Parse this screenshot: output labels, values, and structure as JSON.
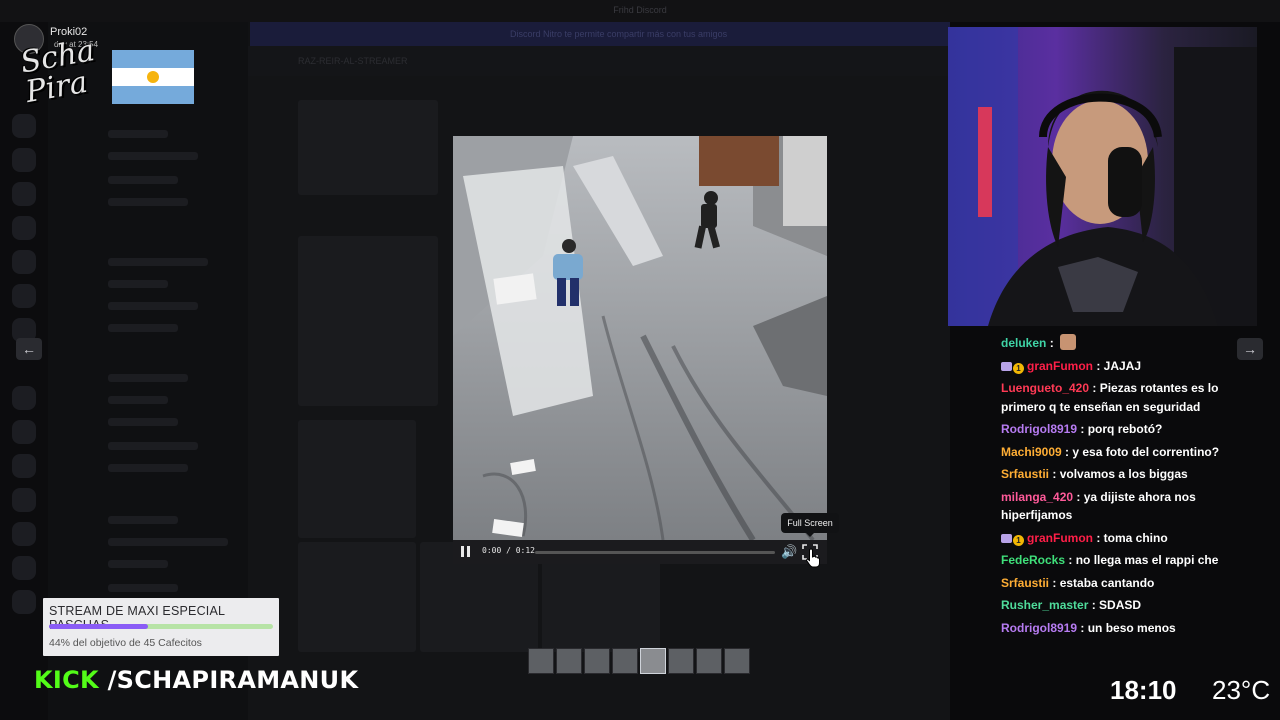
{
  "background": {
    "window_title": "Frihd Discord",
    "banner_text": "Discord Nitro te permite compartir más con tus amigos",
    "channel_header": "RAZ-REIR-AL-STREAMER"
  },
  "user_overlay": {
    "name": "Proki02",
    "time": "day at 23:54",
    "logo_text": "Scha Pira"
  },
  "video": {
    "time": "0:00 / 0:12",
    "progress": 0.0,
    "tooltip": "Full Screen",
    "thumbnail_count": 8,
    "active_thumbnail": 4
  },
  "nav": {
    "prev": "←",
    "next": "→"
  },
  "chat": [
    {
      "user": "deluken",
      "color": "#3fd4a6",
      "text": "",
      "emote": true,
      "badges": []
    },
    {
      "user": "granFumon",
      "color": "#ff1f48",
      "text": "JAJAJ",
      "badges": [
        "sub",
        "gold"
      ]
    },
    {
      "user": "Luengueto_420",
      "color": "#ff3a55",
      "text": "Piezas rotantes es lo primero q te enseñan en seguridad",
      "badges": []
    },
    {
      "user": "Rodrigol8919",
      "color": "#b77cf2",
      "text": "porq rebotó?",
      "badges": []
    },
    {
      "user": "Machi9009",
      "color": "#ffae35",
      "text": "y esa foto del correntino?",
      "badges": []
    },
    {
      "user": "Srfaustii",
      "color": "#ffae35",
      "text": "volvamos a los biggas",
      "badges": []
    },
    {
      "user": "milanga_420",
      "color": "#ff5a9a",
      "text": "ya dijiste ahora nos hiperfijamos",
      "badges": []
    },
    {
      "user": "granFumon",
      "color": "#ff1f48",
      "text": "toma chino",
      "badges": [
        "sub",
        "gold"
      ]
    },
    {
      "user": "FedeRocks",
      "color": "#3fe07a",
      "text": "no llega mas el rappi che",
      "badges": []
    },
    {
      "user": "Srfaustii",
      "color": "#ffae35",
      "text": "estaba cantando",
      "badges": []
    },
    {
      "user": "Rusher_master",
      "color": "#4fdc9b",
      "text": "SDASD",
      "badges": []
    },
    {
      "user": "Rodrigol8919",
      "color": "#b77cf2",
      "text": "un beso menos",
      "badges": []
    }
  ],
  "goal": {
    "title": "STREAM DE MAXI ESPECIAL PASCUAS",
    "subtitle": "44% del objetivo de 45 Cafecitos",
    "progress": 0.44
  },
  "brand": {
    "kick": "KICK",
    "handle": "/SCHAPIRAMANUK",
    "kick_color": "#53fc18"
  },
  "status": {
    "clock": "18:10",
    "temperature": "23°C"
  }
}
